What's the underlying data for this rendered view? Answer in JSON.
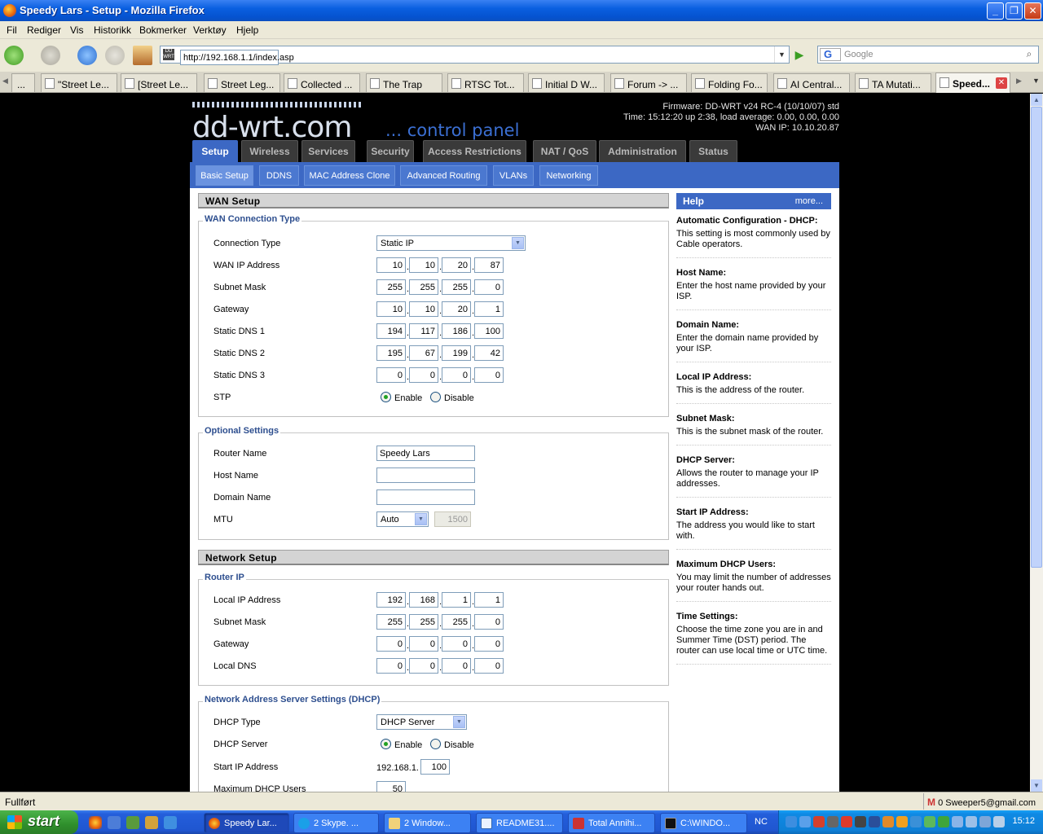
{
  "window": {
    "title": "Speedy Lars - Setup - Mozilla Firefox"
  },
  "menu": [
    "Fil",
    "Rediger",
    "Vis",
    "Historikk",
    "Bokmerker",
    "Verktøy",
    "Hjelp"
  ],
  "nav": {
    "url": "http://192.168.1.1/index.asp",
    "search_placeholder": "Google",
    "search_engine": "G"
  },
  "tabs": [
    "\"Street Le...",
    "[Street Le...",
    "Street Leg...",
    "Collected ...",
    "The Trap",
    "RTSC Tot...",
    "Initial D W...",
    "Forum -> ...",
    "Folding Fo...",
    "AI Central...",
    "TA Mutati...",
    "Speed..."
  ],
  "tabs_prefix": "...",
  "router": {
    "logo": "dd-wrt.com",
    "tagline": "... control panel",
    "firmware": "Firmware: DD-WRT v24 RC-4 (10/10/07) std",
    "time": "Time: 15:12:20 up 2:38, load average: 0.00, 0.00, 0.00",
    "wan_ip": "WAN IP: 10.10.20.87",
    "main_tabs": [
      "Setup",
      "Wireless",
      "Services",
      "Security",
      "Access Restrictions",
      "NAT / QoS",
      "Administration",
      "Status"
    ],
    "sub_tabs": [
      "Basic Setup",
      "DDNS",
      "MAC Address Clone",
      "Advanced Routing",
      "VLANs",
      "Networking"
    ]
  },
  "wan": {
    "header": "WAN Setup",
    "legend": "WAN Connection Type",
    "conn_type_label": "Connection Type",
    "conn_type": "Static IP",
    "wan_ip_label": "WAN IP Address",
    "wan_ip": [
      "10",
      "10",
      "20",
      "87"
    ],
    "mask_label": "Subnet Mask",
    "mask": [
      "255",
      "255",
      "255",
      "0"
    ],
    "gw_label": "Gateway",
    "gw": [
      "10",
      "10",
      "20",
      "1"
    ],
    "dns1_label": "Static DNS 1",
    "dns1": [
      "194",
      "117",
      "186",
      "100"
    ],
    "dns2_label": "Static DNS 2",
    "dns2": [
      "195",
      "67",
      "199",
      "42"
    ],
    "dns3_label": "Static DNS 3",
    "dns3": [
      "0",
      "0",
      "0",
      "0"
    ],
    "stp_label": "STP",
    "enable": "Enable",
    "disable": "Disable"
  },
  "optional": {
    "legend": "Optional Settings",
    "router_name_label": "Router Name",
    "router_name": "Speedy Lars",
    "host_name_label": "Host Name",
    "host_name": "",
    "domain_name_label": "Domain Name",
    "domain_name": "",
    "mtu_label": "MTU",
    "mtu_mode": "Auto",
    "mtu_value": "1500"
  },
  "network": {
    "header": "Network Setup",
    "legend": "Router IP",
    "lip_label": "Local IP Address",
    "lip": [
      "192",
      "168",
      "1",
      "1"
    ],
    "mask_label": "Subnet Mask",
    "mask": [
      "255",
      "255",
      "255",
      "0"
    ],
    "gw_label": "Gateway",
    "gw": [
      "0",
      "0",
      "0",
      "0"
    ],
    "dns_label": "Local DNS",
    "dns": [
      "0",
      "0",
      "0",
      "0"
    ]
  },
  "dhcp": {
    "legend": "Network Address Server Settings (DHCP)",
    "type_label": "DHCP Type",
    "type": "DHCP Server",
    "server_label": "DHCP Server",
    "enable": "Enable",
    "disable": "Disable",
    "start_label": "Start IP Address",
    "start_prefix": "192.168.1.",
    "start": "100",
    "max_label": "Maximum DHCP Users",
    "max": "50"
  },
  "help": {
    "title": "Help",
    "more": "more...",
    "items": [
      {
        "t": "Automatic Configuration - DHCP:",
        "d": "This setting is most commonly used by Cable operators."
      },
      {
        "t": "Host Name:",
        "d": "Enter the host name provided by your ISP."
      },
      {
        "t": "Domain Name:",
        "d": "Enter the domain name provided by your ISP."
      },
      {
        "t": "Local IP Address:",
        "d": "This is the address of the router."
      },
      {
        "t": "Subnet Mask:",
        "d": "This is the subnet mask of the router."
      },
      {
        "t": "DHCP Server:",
        "d": "Allows the router to manage your IP addresses."
      },
      {
        "t": "Start IP Address:",
        "d": "The address you would like to start with."
      },
      {
        "t": "Maximum DHCP Users:",
        "d": "You may limit the number of addresses your router hands out."
      },
      {
        "t": "Time Settings:",
        "d": "Choose the time zone you are in and Summer Time (DST) period. The router can use local time or UTC time."
      }
    ]
  },
  "status": {
    "left": "Fullført",
    "gmail": "0 Sweeper5@gmail.com"
  },
  "taskbar": {
    "start": "start",
    "items": [
      "Speedy Lar...",
      "2 Skype. ...",
      "2 Window...",
      "README31....",
      "Total Annihi...",
      "C:\\WINDO..."
    ],
    "lang": "NC",
    "clock": "15:12"
  }
}
